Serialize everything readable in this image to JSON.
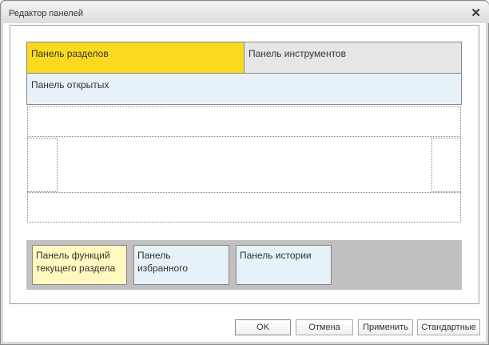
{
  "window": {
    "title": "Редактор панелей",
    "close_icon": "close-icon"
  },
  "panels": {
    "sections": "Панель разделов",
    "tools": "Панель инструментов",
    "open": "Панель открытых",
    "functions": "Панель функций текущего раздела",
    "favorites": "Панель избранного",
    "history": "Панель истории"
  },
  "colors": {
    "sections": "#fbd91f",
    "tools": "#e6e6e6",
    "open": "#e6f2f8",
    "functions": "#fff9c0",
    "bottom_area": "#c0c0c0"
  },
  "buttons": {
    "ok": "OK",
    "cancel": "Отмена",
    "apply": "Применить",
    "defaults": "Стандартные"
  }
}
